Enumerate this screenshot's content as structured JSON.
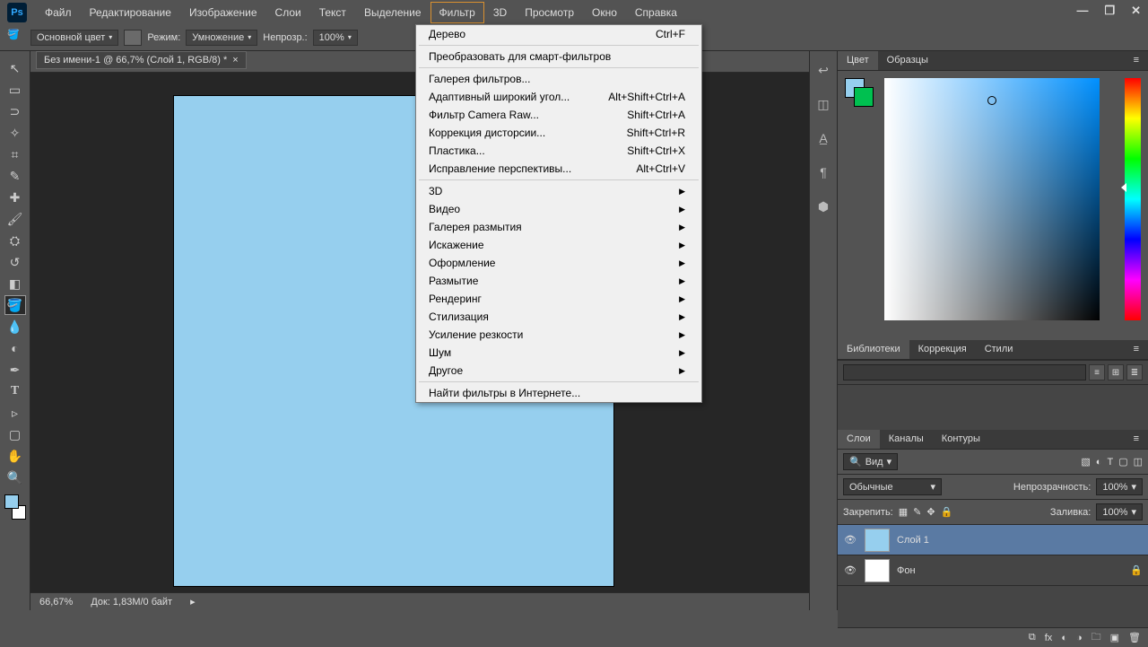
{
  "menubar": {
    "items": [
      "Файл",
      "Редактирование",
      "Изображение",
      "Слои",
      "Текст",
      "Выделение",
      "Фильтр",
      "3D",
      "Просмотр",
      "Окно",
      "Справка"
    ],
    "active_index": 6
  },
  "toolbar": {
    "color_mode": "Основной цвет",
    "mode_label": "Режим:",
    "mode_value": "Умножение",
    "opacity_label": "Непрозр.:",
    "opacity_value": "100%"
  },
  "document": {
    "tab_title": "Без имени-1 @ 66,7% (Слой 1, RGB/8) *"
  },
  "status": {
    "zoom": "66,67%",
    "doc_info": "Док: 1,83M/0 байт"
  },
  "dropdown": {
    "groups": [
      [
        {
          "label": "Дерево",
          "shortcut": "Ctrl+F"
        }
      ],
      [
        {
          "label": "Преобразовать для смарт-фильтров"
        }
      ],
      [
        {
          "label": "Галерея фильтров..."
        },
        {
          "label": "Адаптивный широкий угол...",
          "shortcut": "Alt+Shift+Ctrl+A"
        },
        {
          "label": "Фильтр Camera Raw...",
          "shortcut": "Shift+Ctrl+A"
        },
        {
          "label": "Коррекция дисторсии...",
          "shortcut": "Shift+Ctrl+R"
        },
        {
          "label": "Пластика...",
          "shortcut": "Shift+Ctrl+X"
        },
        {
          "label": "Исправление перспективы...",
          "shortcut": "Alt+Ctrl+V"
        }
      ],
      [
        {
          "label": "3D",
          "submenu": true
        },
        {
          "label": "Видео",
          "submenu": true
        },
        {
          "label": "Галерея размытия",
          "submenu": true
        },
        {
          "label": "Искажение",
          "submenu": true
        },
        {
          "label": "Оформление",
          "submenu": true
        },
        {
          "label": "Размытие",
          "submenu": true
        },
        {
          "label": "Рендеринг",
          "submenu": true
        },
        {
          "label": "Стилизация",
          "submenu": true
        },
        {
          "label": "Усиление резкости",
          "submenu": true
        },
        {
          "label": "Шум",
          "submenu": true
        },
        {
          "label": "Другое",
          "submenu": true
        }
      ],
      [
        {
          "label": "Найти фильтры в Интернете..."
        }
      ]
    ]
  },
  "panels": {
    "color_tabs": [
      "Цвет",
      "Образцы"
    ],
    "lib_tabs": [
      "Библиотеки",
      "Коррекция",
      "Стили"
    ],
    "layers_tabs": [
      "Слои",
      "Каналы",
      "Контуры"
    ],
    "kind_label": "Вид",
    "blend_mode": "Обычные",
    "opacity_label": "Непрозрачность:",
    "opacity_value": "100%",
    "lock_label": "Закрепить:",
    "fill_label": "Заливка:",
    "fill_value": "100%",
    "layers": [
      {
        "name": "Слой 1",
        "thumb_color": "#96cfee",
        "locked": false,
        "selected": true
      },
      {
        "name": "Фон",
        "thumb_color": "#ffffff",
        "locked": true,
        "selected": false
      }
    ]
  }
}
